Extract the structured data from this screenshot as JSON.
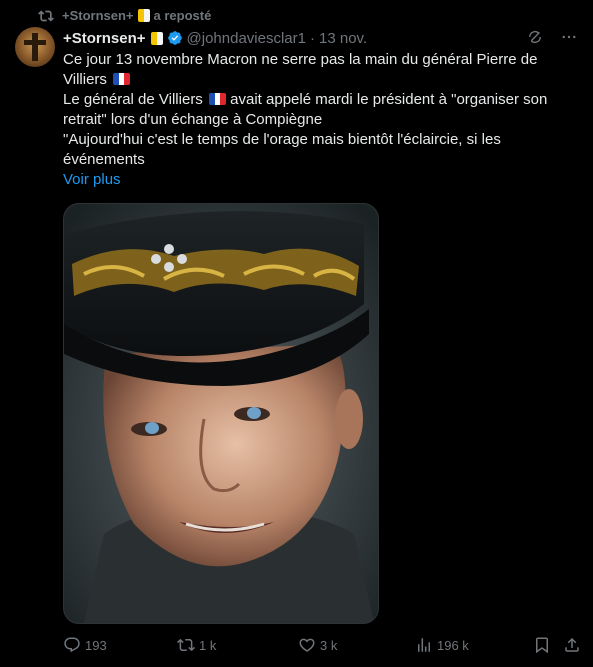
{
  "repost": {
    "icon": "repost-icon",
    "user": "+Stornsen+",
    "suffix": "a reposté"
  },
  "author": {
    "name": "+Stornsen+",
    "handle": "@johndaviesclar1",
    "separator": "·",
    "date": "13 nov.",
    "verified_color": "#1d9bf0"
  },
  "tweet": {
    "line1": "Ce jour 13 novembre Macron ne serre pas la main du général Pierre de Villiers",
    "line2a": "Le général de Villiers",
    "line2b": "avait appelé mardi le président à \"organiser son retrait\" lors d'un échange à Compiègne",
    "line3": "\"Aujourd'hui c'est le temps de l'orage mais bientôt l'éclaircie, si les événements",
    "see_more": "Voir plus"
  },
  "actions": {
    "replies": "193",
    "reposts": "1 k",
    "likes": "3 k",
    "views": "196 k"
  },
  "colors": {
    "background": "#000000",
    "text": "#e7e9ea",
    "muted": "#71767b",
    "accent": "#1d9bf0",
    "border": "#2f3336"
  }
}
